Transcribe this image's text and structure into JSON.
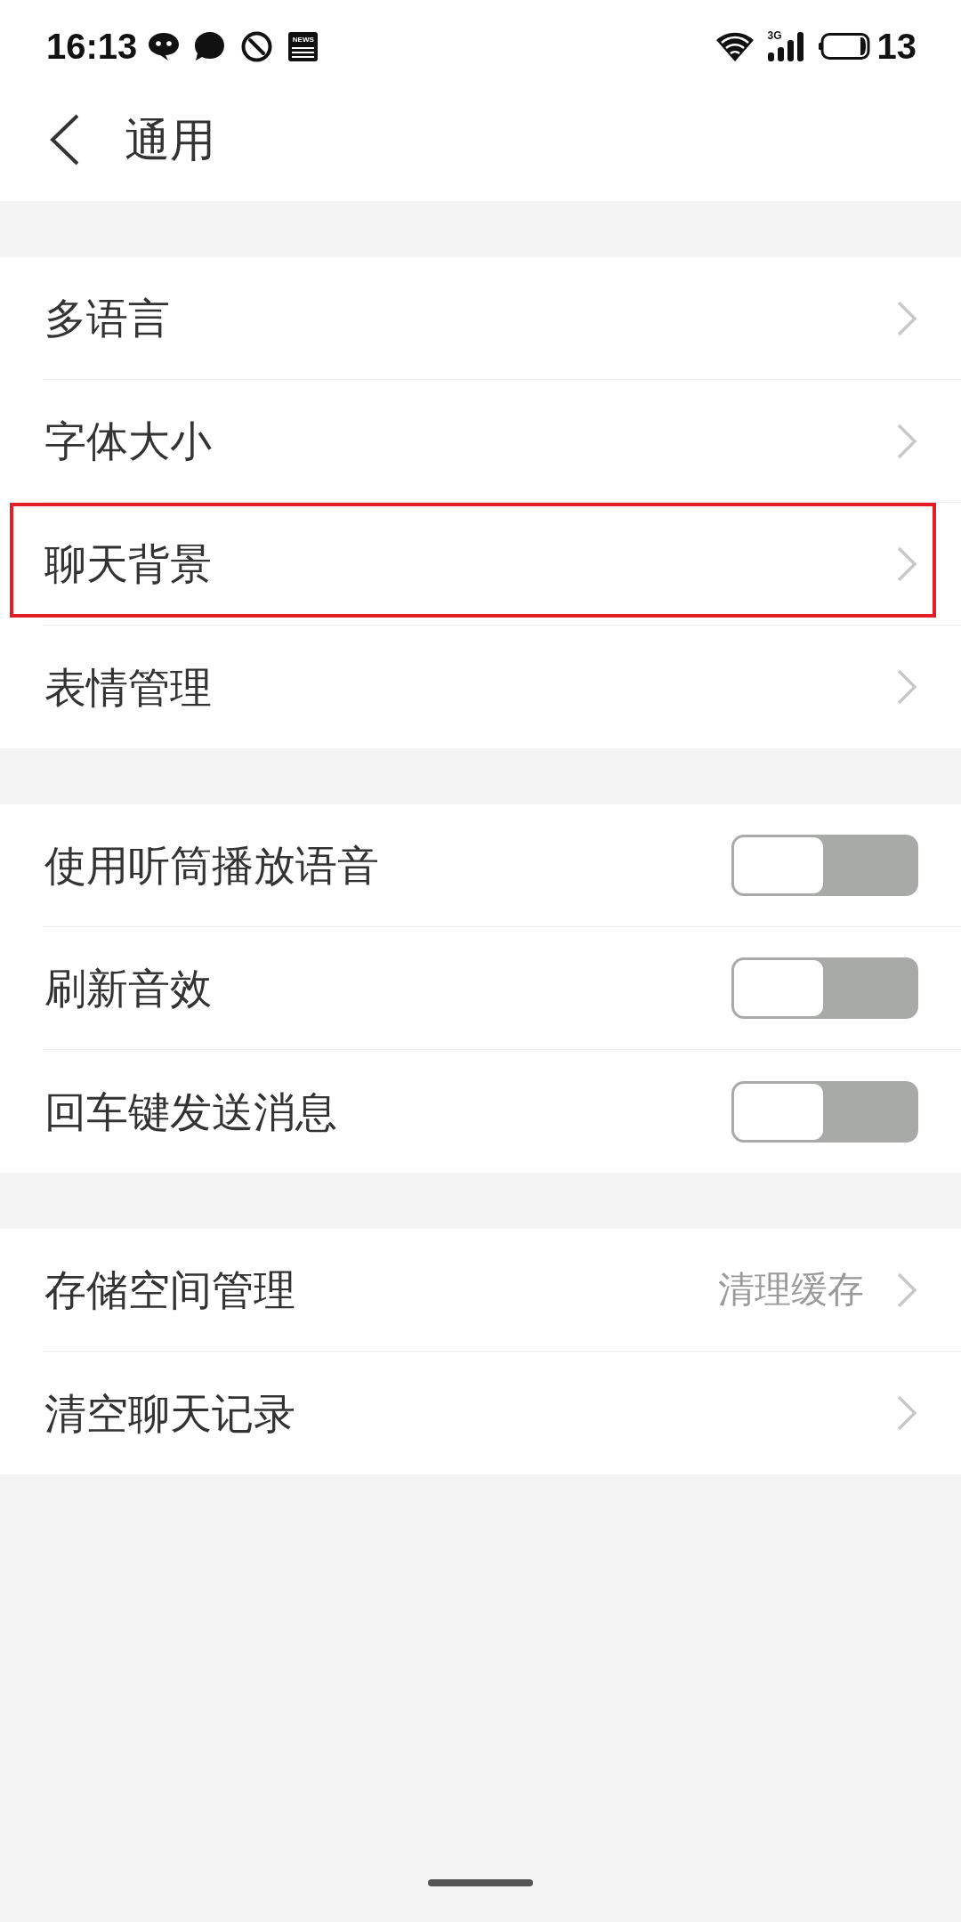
{
  "status_bar": {
    "time": "16:13",
    "news_icon_text": "NEWS",
    "network_type": "3G",
    "battery": "13"
  },
  "header": {
    "title": "通用"
  },
  "groups": [
    {
      "items": [
        {
          "kind": "link",
          "label": "多语言",
          "highlighted": false
        },
        {
          "kind": "link",
          "label": "字体大小",
          "highlighted": false
        },
        {
          "kind": "link",
          "label": "聊天背景",
          "highlighted": true
        },
        {
          "kind": "link",
          "label": "表情管理",
          "highlighted": false
        }
      ]
    },
    {
      "items": [
        {
          "kind": "toggle",
          "label": "使用听筒播放语音",
          "on": false,
          "highlighted": false
        },
        {
          "kind": "toggle",
          "label": "刷新音效",
          "on": false,
          "highlighted": false
        },
        {
          "kind": "toggle",
          "label": "回车键发送消息",
          "on": false,
          "highlighted": false
        }
      ]
    },
    {
      "items": [
        {
          "kind": "link",
          "label": "存储空间管理",
          "value": "清理缓存",
          "highlighted": false
        },
        {
          "kind": "link",
          "label": "清空聊天记录",
          "highlighted": false
        }
      ]
    }
  ]
}
